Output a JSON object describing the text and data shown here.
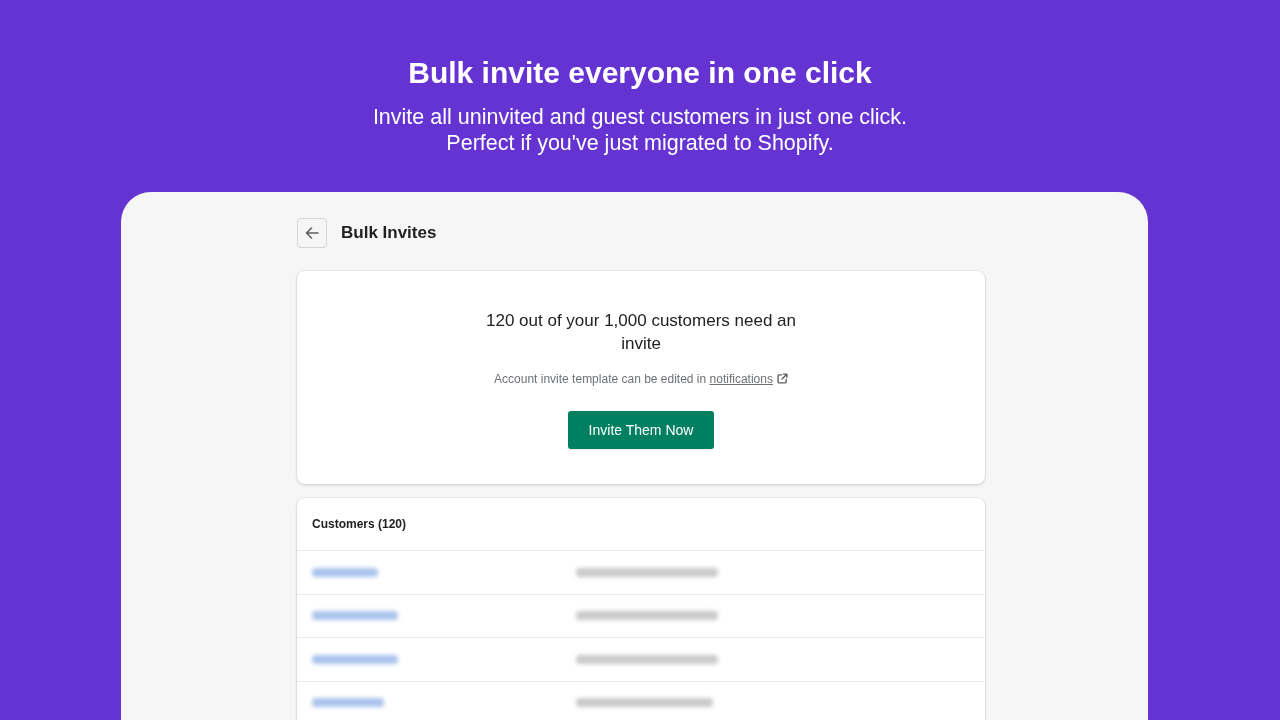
{
  "header": {
    "title": "Bulk invite everyone in one click",
    "subtitle_lines": [
      "Invite all uninvited and guest customers in just one click.",
      "Perfect if you've just migrated to Shopify."
    ]
  },
  "page": {
    "title": "Bulk Invites"
  },
  "summary_card": {
    "message": "120 out of your 1,000 customers need an invite",
    "note": "Account invite template can be edited in",
    "note_link": "notifications",
    "button": "Invite Them Now"
  },
  "customers": {
    "title": "Customers (120)",
    "rows": [
      {
        "kind": "redacted"
      },
      {
        "kind": "redacted"
      },
      {
        "kind": "redacted"
      },
      {
        "kind": "redacted"
      }
    ]
  }
}
